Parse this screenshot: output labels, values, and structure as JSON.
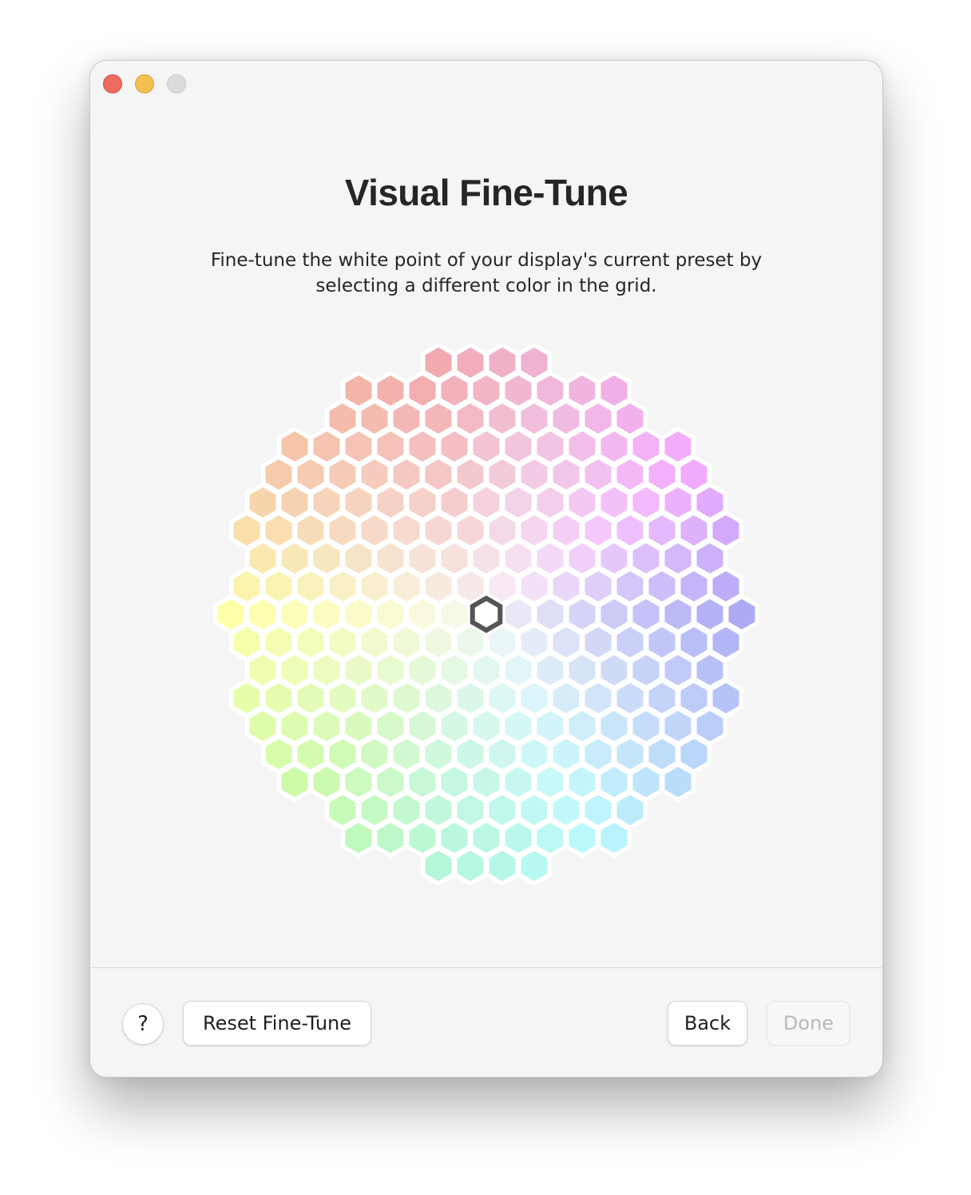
{
  "window": {
    "controls": [
      "close-button",
      "minimize-button",
      "zoom-button"
    ]
  },
  "title": "Visual Fine-Tune",
  "subtitle_line1": "Fine-tune the white point of your display's current preset by",
  "subtitle_line2": "selecting a different color in the grid.",
  "grid": {
    "row_counts": [
      4,
      9,
      10,
      13,
      14,
      15,
      16,
      15,
      16,
      17,
      16,
      15,
      16,
      15,
      14,
      13,
      10,
      9,
      4
    ],
    "selected_row": 9,
    "selected_col": 8,
    "colors": {
      "red": "#f2a4a6",
      "magenta": "#f2a6ff",
      "pink": "#eeb0d6",
      "blue_violet": "#a9a6f6",
      "blue": "#b6cff8",
      "cyan": "#b6f8ff",
      "aqua_green": "#b0f7d8",
      "green": "#c7fba6",
      "yellow": "#feffa4",
      "orange": "#f6cca6",
      "white": "#f7f7f7"
    }
  },
  "buttons": {
    "help_label": "?",
    "reset_label": "Reset Fine-Tune",
    "back_label": "Back",
    "done_label": "Done"
  }
}
